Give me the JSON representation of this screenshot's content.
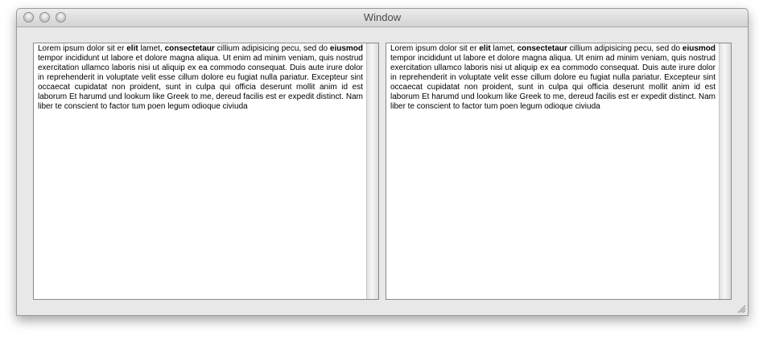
{
  "window": {
    "title": "Window"
  },
  "text": {
    "seg1": "Lorem ipsum dolor sit er ",
    "bold1": "elit",
    "seg2": " lamet, ",
    "bold2": "consectetaur",
    "seg3": " cillium adipisicing pecu, sed do ",
    "bold3": "eiusmod",
    "seg4": " tempor incididunt ut labore et dolore magna aliqua. Ut enim ad minim veniam, quis nostrud exercitation ullamco laboris nisi ut aliquip ex ea commodo consequat. Duis aute irure dolor in reprehenderit in voluptate velit esse cillum dolore eu fugiat nulla pariatur. Excepteur sint occaecat cupidatat non proident, sunt in culpa qui officia deserunt mollit anim id est laborum Et harumd und lookum like Greek to me, dereud facilis est er expedit distinct. Nam liber te conscient to factor tum poen legum odioque civiuda"
  },
  "icons": {
    "close": "close-icon",
    "minimize": "minimize-icon",
    "zoom": "zoom-icon",
    "resize": "resize-grip-icon"
  }
}
